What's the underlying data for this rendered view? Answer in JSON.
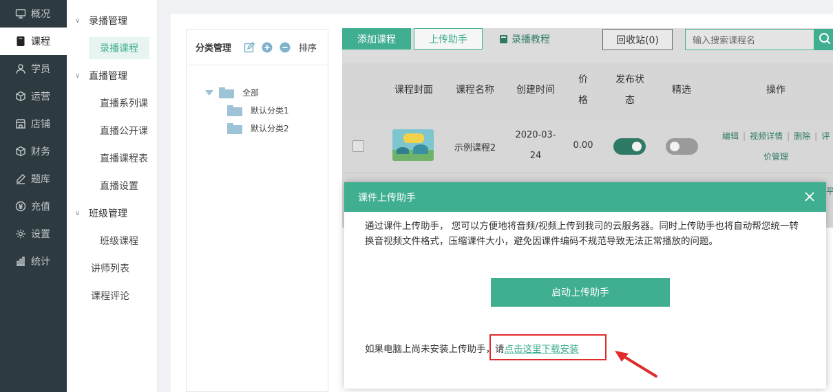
{
  "sidebar": {
    "items": [
      {
        "label": "概况",
        "icon": "monitor-icon"
      },
      {
        "label": "课程",
        "icon": "book-icon",
        "active": true
      },
      {
        "label": "学员",
        "icon": "user-icon"
      },
      {
        "label": "运营",
        "icon": "cube-icon"
      },
      {
        "label": "店铺",
        "icon": "shop-icon"
      },
      {
        "label": "财务",
        "icon": "cube-icon"
      },
      {
        "label": "题库",
        "icon": "pen-icon"
      },
      {
        "label": "充值",
        "icon": "yen-icon"
      },
      {
        "label": "设置",
        "icon": "gear-icon"
      },
      {
        "label": "统计",
        "icon": "bar-chart-icon"
      }
    ]
  },
  "subnav": {
    "group1": "录播管理",
    "group1_items": [
      "录播课程"
    ],
    "group2": "直播管理",
    "group2_items": [
      "直播系列课",
      "直播公开课",
      "直播课程表",
      "直播设置"
    ],
    "group3": "班级管理",
    "group3_items": [
      "班级课程"
    ],
    "flat_items": [
      "讲师列表",
      "课程评论"
    ]
  },
  "category": {
    "title": "分类管理",
    "sort_label": "排序",
    "root": "全部",
    "children": [
      "默认分类1",
      "默认分类2"
    ]
  },
  "toolbar": {
    "add_label": "添加课程",
    "upload_label": "上传助手",
    "tutorial_label": "录播教程",
    "recycle_label": "回收站(0)",
    "search_placeholder": "输入搜索课程名"
  },
  "table": {
    "headers": {
      "cover": "课程封面",
      "name": "课程名称",
      "created": "创建时间",
      "price_l1": "价",
      "price_l2": "格",
      "status_l1": "发布状",
      "status_l2": "态",
      "featured": "精选",
      "ops": "操作"
    },
    "row1": {
      "name": "示例课程2",
      "date_l1": "2020-03-",
      "date_l2": "24",
      "price": "0.00",
      "ops": [
        "编辑",
        "视频详情",
        "删除",
        "评"
      ],
      "ops_line2": "价管理",
      "published": true,
      "featured": false
    },
    "row2": {
      "ops_partial": "平"
    }
  },
  "modal": {
    "title": "课件上传助手",
    "description": "通过课件上传助手， 您可以方便地将音频/视频上传到我司的云服务器。同时上传助手也将自动帮您统一转换音视频文件格式，压缩课件大小，避免因课件编码不规范导致无法正常播放的问题。",
    "launch_label": "启动上传助手",
    "install_prefix": "如果电脑上尚未安装上传助手，请",
    "install_link": "点击这里下载安装"
  },
  "colors": {
    "accent": "#3fae91",
    "sidebar_bg": "#2d3a40",
    "highlight": "#e02b2b"
  }
}
